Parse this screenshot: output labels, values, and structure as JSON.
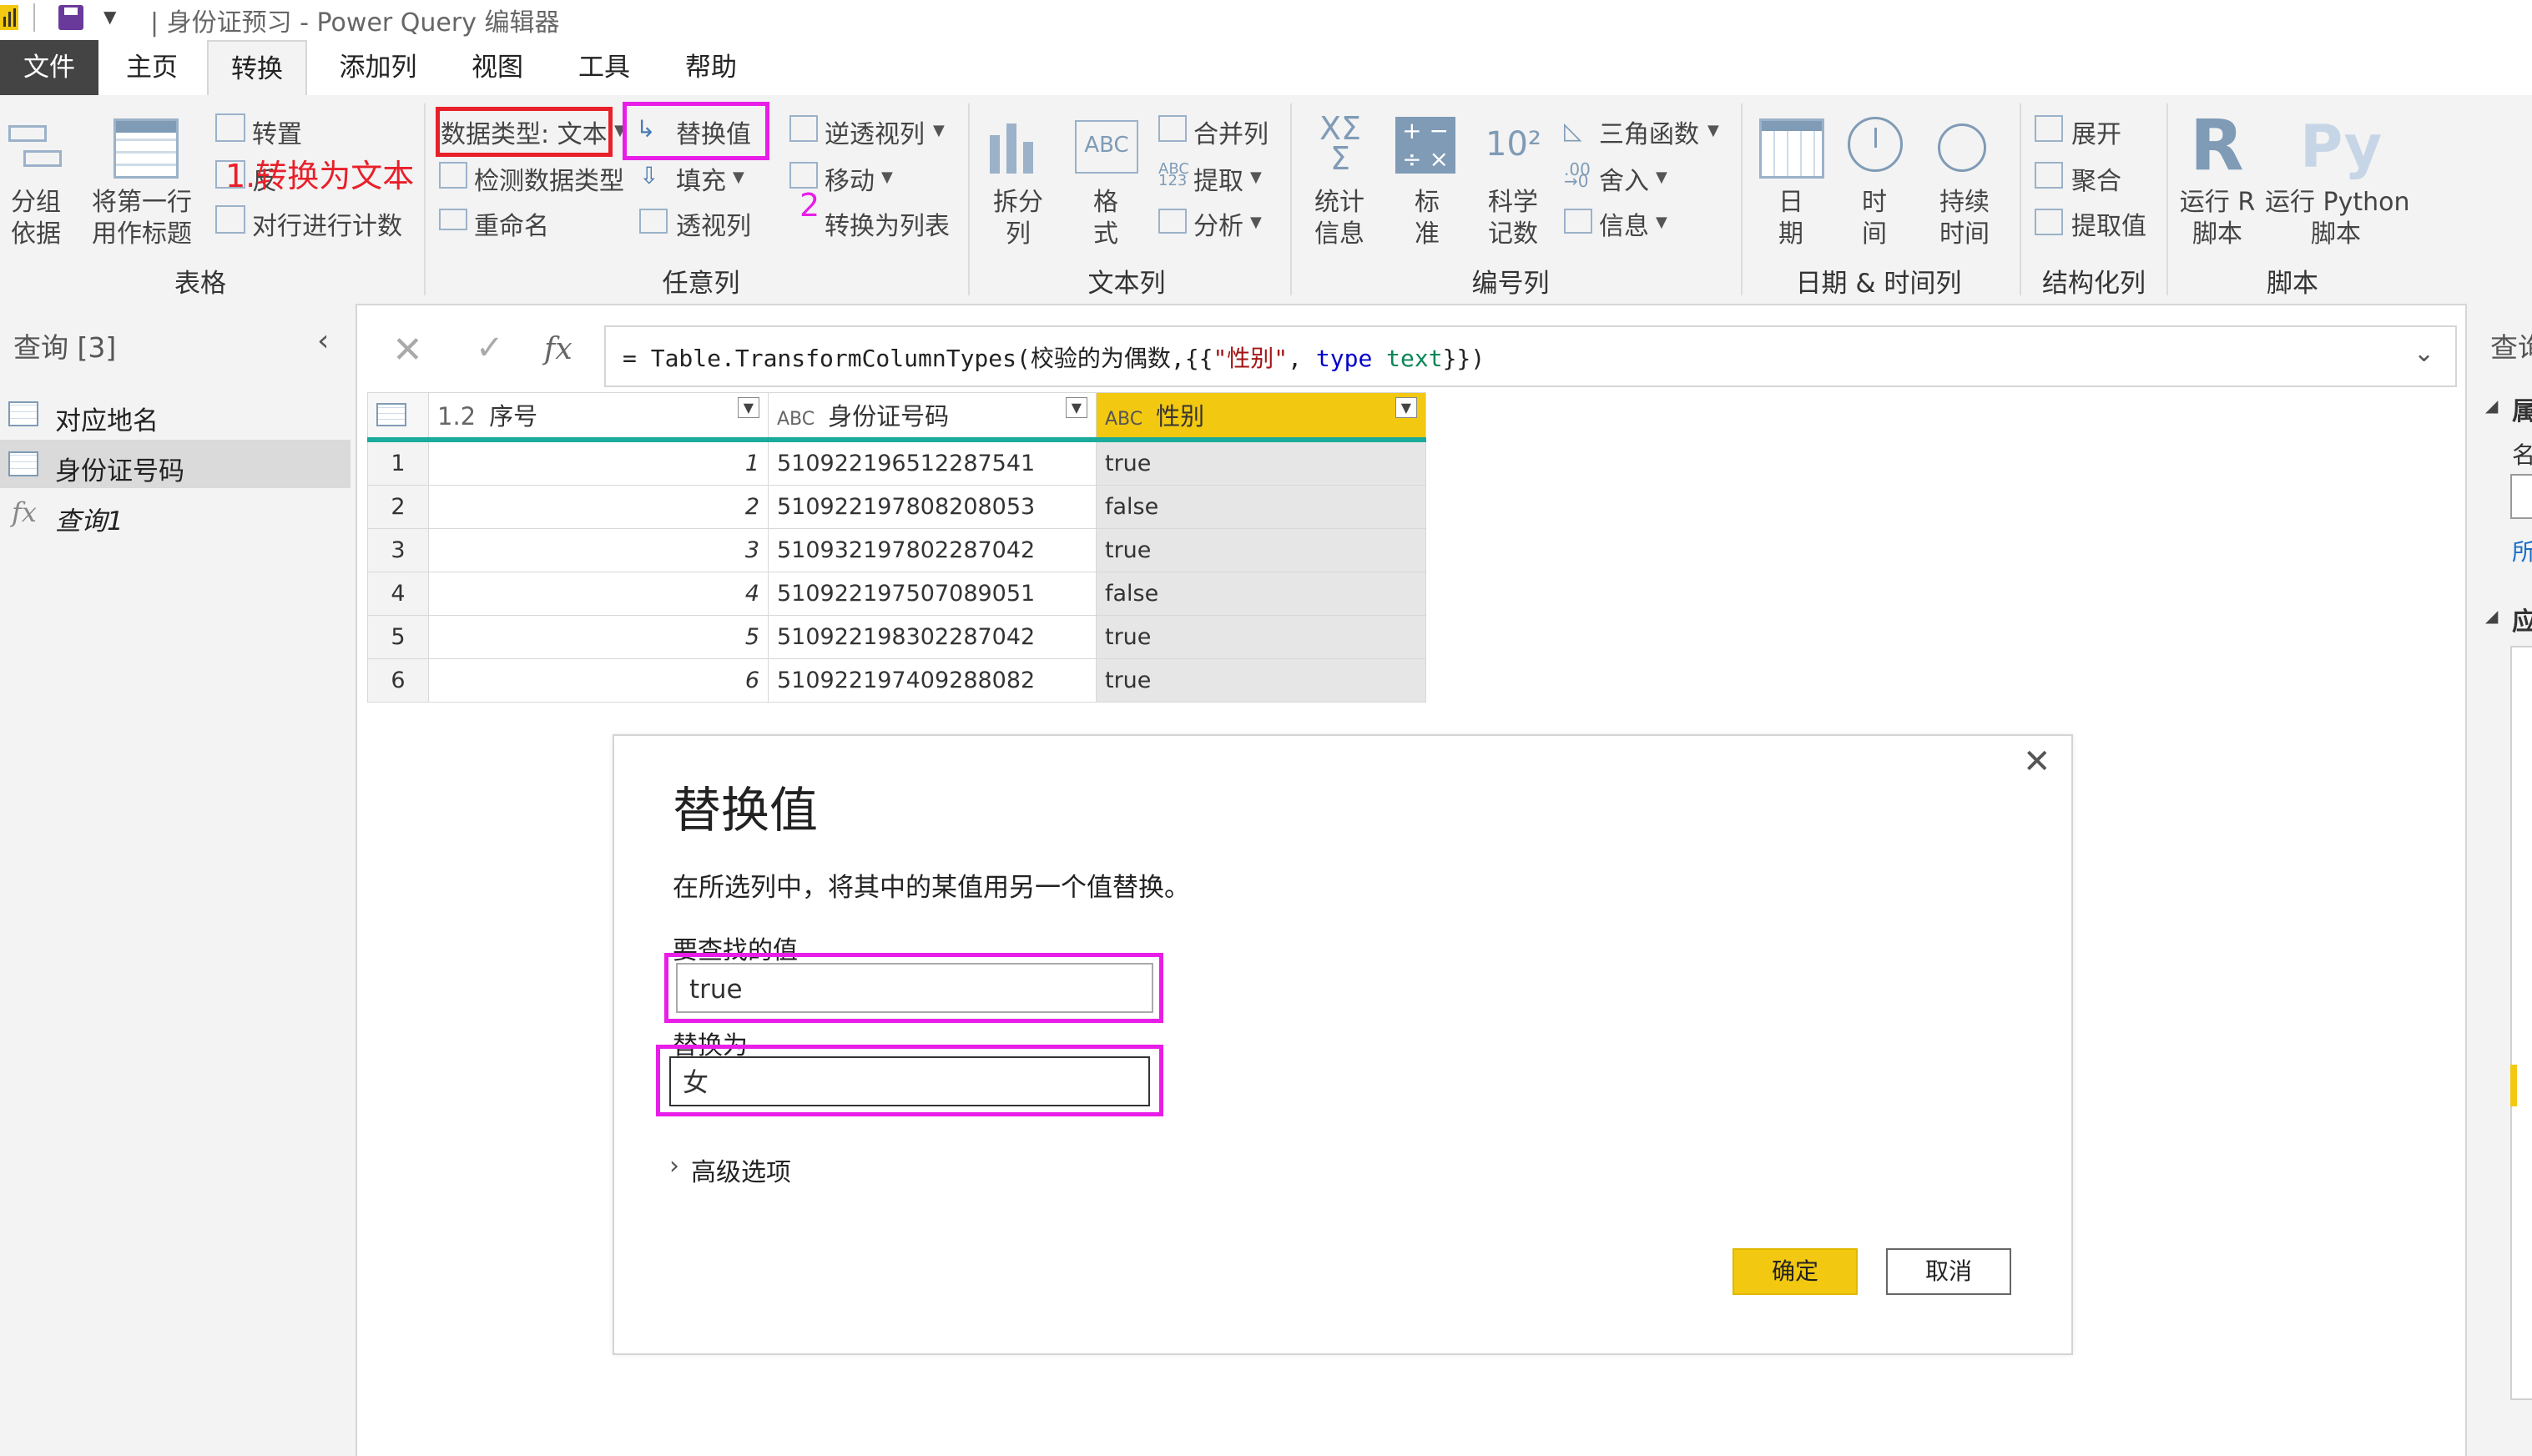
{
  "window": {
    "title": "| 身份证预习 - Power Query 编辑器"
  },
  "menu": {
    "tabs": [
      "文件",
      "主页",
      "转换",
      "添加列",
      "视图",
      "工具",
      "帮助"
    ]
  },
  "ribbon": {
    "table_group": {
      "group_by": "分组\n依据",
      "use_first_row": "将第一行\n用作标题",
      "transpose": "转置",
      "reverse": "反",
      "count_rows": "对行进行计数",
      "label": "表格"
    },
    "any_col_group": {
      "data_type": "数据类型: 文本",
      "detect_type": "检测数据类型",
      "rename": "重命名",
      "replace": "替换值",
      "fill": "填充",
      "pivot": "透视列",
      "unpivot": "逆透视列",
      "move": "移动",
      "to_list": "转换为列表",
      "label": "任意列"
    },
    "text_col_group": {
      "split": "拆分\n列",
      "format": "格\n式",
      "merge": "合并列",
      "extract": "提取",
      "parse": "分析",
      "label": "文本列"
    },
    "number_col_group": {
      "stats": "统计\n信息",
      "standard": "标\n准",
      "scientific": "科学\n记数",
      "trig": "三角函数",
      "round": "舍入",
      "info": "信息",
      "label": "编号列"
    },
    "datetime_group": {
      "date": "日\n期",
      "time": "时\n间",
      "duration": "持续\n时间",
      "label": "日期 & 时间列"
    },
    "struct_group": {
      "expand": "展开",
      "aggregate": "聚合",
      "extract_values": "提取值",
      "label": "结构化列"
    },
    "script_group": {
      "run_r": "运行 R\n脚本",
      "run_py": "运行 Python\n脚本",
      "label": "脚本"
    }
  },
  "annotations": {
    "step1": "1.转换为文本",
    "step2": "2"
  },
  "queries": {
    "header": "查询 [3]",
    "items": [
      "对应地名",
      "身份证号码",
      "查询1"
    ]
  },
  "formula": {
    "prefix": "= Table.TransformColumnTypes(校验的为偶数,{{",
    "str": "\"性别\"",
    "comma": ", ",
    "kw": "type",
    "type": " text",
    "suffix": "}})"
  },
  "table": {
    "columns": [
      {
        "type": "1.2",
        "name": "序号"
      },
      {
        "type": "ABC",
        "name": "身份证号码"
      },
      {
        "type": "ABC",
        "name": "性别"
      }
    ],
    "rows": [
      [
        "1",
        "1",
        "510922196512287541",
        "true"
      ],
      [
        "2",
        "2",
        "510922197808208053",
        "false"
      ],
      [
        "3",
        "3",
        "510932197802287042",
        "true"
      ],
      [
        "4",
        "4",
        "510922197507089051",
        "false"
      ],
      [
        "5",
        "5",
        "510922198302287042",
        "true"
      ],
      [
        "6",
        "6",
        "510922197409288082",
        "true"
      ]
    ]
  },
  "dialog": {
    "title": "替换值",
    "description": "在所选列中，将其中的某值用另一个值替换。",
    "find_label": "要查找的值",
    "find_value": "true",
    "replace_label": "替换为",
    "replace_value": "女",
    "advanced": "高级选项",
    "ok": "确定",
    "cancel": "取消"
  },
  "right": {
    "header": "查询",
    "c1": "属",
    "c2": "名",
    "c3": "所",
    "c4": "应"
  },
  "colors": {
    "accent": "#f2c811",
    "highlight": "#e81ee8",
    "annotation": "#e8202a",
    "teal": "#1aab9b"
  }
}
